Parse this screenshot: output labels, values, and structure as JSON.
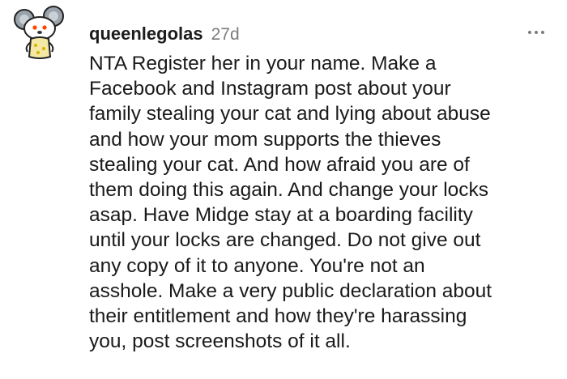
{
  "comment": {
    "username": "queenlegolas",
    "age": "27d",
    "more_icon": "more-dots-icon",
    "avatar_icon": "snoo-avatar-icon",
    "lines": [
      "NTA Register her in your name. Make a",
      "Facebook and Instagram post about your",
      "family stealing your cat and lying about abuse",
      "and how your mom supports the thieves",
      "stealing your cat. And how afraid you are of",
      "them doing this again. And change your locks",
      "asap. Have Midge stay at a boarding facility",
      "until your locks are changed. Do not give out",
      "any copy of it to anyone. You're not an",
      "asshole. Make a very public declaration about",
      "their entitlement and how they're harassing",
      "you, post screenshots of it all."
    ]
  },
  "colors": {
    "username": "#1c1c1c",
    "age": "#7c7c7c",
    "text": "#1a1a1b",
    "avatar_outfit": "#f3e9a4"
  }
}
